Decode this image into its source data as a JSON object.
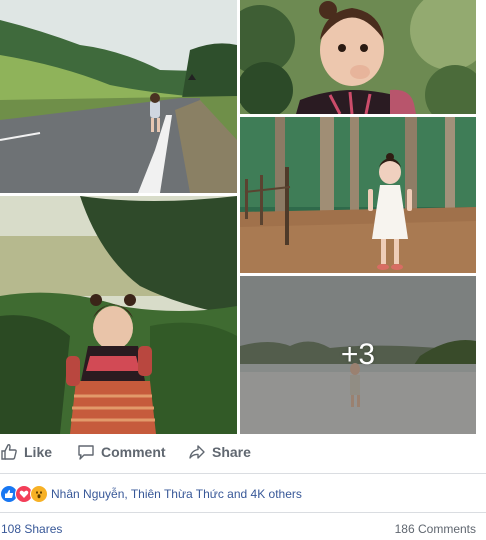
{
  "photos": {
    "more_count": "+3"
  },
  "actions": {
    "like_label": "Like",
    "comment_label": "Comment",
    "share_label": "Share"
  },
  "reactions": {
    "icons": [
      "like-icon",
      "love-icon",
      "wow-icon"
    ],
    "names": "Nhân Nguyễn, Thiên Thừa Thức and 4K others"
  },
  "counts": {
    "shares": "108 Shares",
    "comments": "186 Comments"
  },
  "colors": {
    "like_blue": "#1877f2",
    "love_red": "#f33e58",
    "wow_yellow": "#f7b125",
    "link_blue": "#385898",
    "muted": "#606770"
  }
}
